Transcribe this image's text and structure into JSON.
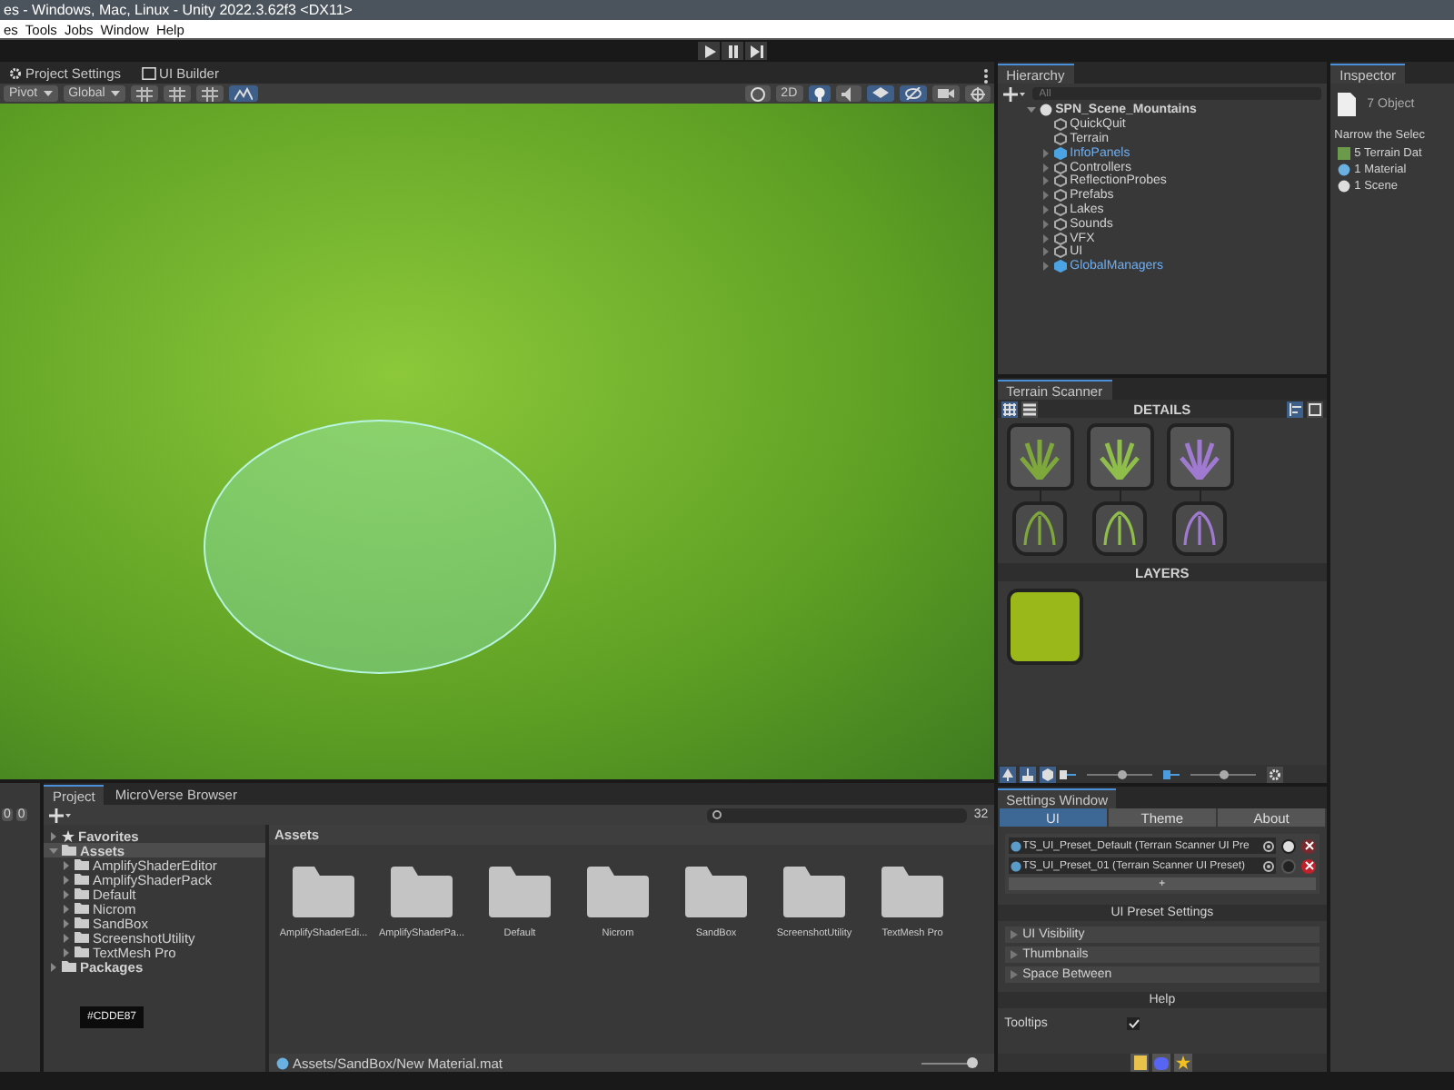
{
  "window": {
    "title": "es - Windows, Mac, Linux - Unity 2022.3.62f3 <DX11>"
  },
  "menu": [
    "es",
    "Tools",
    "Jobs",
    "Window",
    "Help"
  ],
  "scene": {
    "tabs": [
      {
        "label": "Project Settings",
        "kind": "gear",
        "selected": false
      },
      {
        "label": "UI Builder",
        "kind": "builder",
        "selected": false
      }
    ],
    "pivot": "Pivot",
    "space": "Global",
    "left_tools": [
      {
        "kind": "grid",
        "on": false
      },
      {
        "kind": "grid",
        "on": false
      },
      {
        "kind": "grid",
        "on": false
      },
      {
        "kind": "terrain",
        "on": true
      }
    ],
    "mode": {
      "label": "2D",
      "on": false
    },
    "toggles": [
      {
        "kind": "lighting",
        "on": true
      },
      {
        "kind": "audio",
        "on": false
      },
      {
        "kind": "effects",
        "on": true
      },
      {
        "kind": "visibility",
        "on": true
      }
    ]
  },
  "hierarchy": {
    "title": "Hierarchy",
    "search_placeholder": "All",
    "scene": "SPN_Scene_Mountains",
    "items": [
      {
        "label": "QuickQuit",
        "has_children": false,
        "prefab": false
      },
      {
        "label": "Terrain",
        "has_children": false,
        "prefab": false
      },
      {
        "label": "InfoPanels",
        "has_children": true,
        "prefab": true
      },
      {
        "label": "Controllers",
        "has_children": true,
        "prefab": false
      },
      {
        "label": "ReflectionProbes",
        "has_children": true,
        "prefab": false
      },
      {
        "label": "Prefabs",
        "has_children": true,
        "prefab": false
      },
      {
        "label": "Lakes",
        "has_children": true,
        "prefab": false
      },
      {
        "label": "Sounds",
        "has_children": true,
        "prefab": false
      },
      {
        "label": "VFX",
        "has_children": true,
        "prefab": false
      },
      {
        "label": "UI",
        "has_children": true,
        "prefab": false
      },
      {
        "label": "GlobalManagers",
        "has_children": true,
        "prefab": true
      }
    ]
  },
  "inspector": {
    "title": "Inspector",
    "summary": "7 Object",
    "narrow": "Narrow the Selec",
    "items": [
      {
        "label": "5 Terrain Dat",
        "kind": "terrain"
      },
      {
        "label": "1 Material",
        "kind": "material"
      },
      {
        "label": "1 Scene",
        "kind": "scene"
      }
    ]
  },
  "terrain_scanner": {
    "title": "Terrain Scanner",
    "details_heading": "DETAILS",
    "details": [
      {
        "color": "#7fa83c"
      },
      {
        "color": "#8fbf4a"
      },
      {
        "color": "#a07ad0"
      }
    ],
    "layers_heading": "LAYERS",
    "layers": [
      {
        "color": "#9bb81a"
      }
    ],
    "sliders": [
      {
        "level": 0.55
      },
      {
        "level": 0.5
      }
    ]
  },
  "project": {
    "tabs": [
      {
        "label": "Project",
        "selected": true
      },
      {
        "label": "MicroVerse Browser",
        "selected": false
      }
    ],
    "count": "32",
    "tree": [
      {
        "label": "Favorites",
        "kind": "favorites",
        "expanded": false,
        "selected": false
      },
      {
        "label": "Assets",
        "kind": "folder",
        "expanded": true,
        "selected": true,
        "children": [
          {
            "label": "AmplifyShaderEditor"
          },
          {
            "label": "AmplifyShaderPack"
          },
          {
            "label": "Default"
          },
          {
            "label": "Nicrom"
          },
          {
            "label": "SandBox"
          },
          {
            "label": "ScreenshotUtility"
          },
          {
            "label": "TextMesh Pro"
          }
        ]
      },
      {
        "label": "Packages",
        "kind": "folder",
        "expanded": false,
        "selected": false
      }
    ],
    "color_tooltip": "#CDDE87",
    "breadcrumb": "Assets",
    "folders": [
      "AmplifyShaderEdi...",
      "AmplifyShaderPa...",
      "Default",
      "Nicrom",
      "SandBox",
      "ScreenshotUtility",
      "TextMesh Pro"
    ],
    "path": "Assets/SandBox/New Material.mat",
    "zoom": {
      "level": 0.95
    }
  },
  "console": {
    "counts": [
      "0",
      "0"
    ]
  },
  "settings_window": {
    "title": "Settings Window",
    "tabs": [
      {
        "label": "UI",
        "selected": true
      },
      {
        "label": "Theme",
        "selected": false
      },
      {
        "label": "About",
        "selected": false
      }
    ],
    "presets": [
      {
        "value": "TS_UI_Preset_Default (Terrain Scanner UI Pre",
        "active": true
      },
      {
        "value": "TS_UI_Preset_01 (Terrain Scanner UI Preset)",
        "active": false
      }
    ],
    "add": "+",
    "section": "UI Preset Settings",
    "foldouts": [
      "UI Visibility",
      "Thumbnails",
      "Space Between"
    ],
    "help": "Help",
    "tooltips": {
      "label": "Tooltips",
      "checked": true
    }
  }
}
